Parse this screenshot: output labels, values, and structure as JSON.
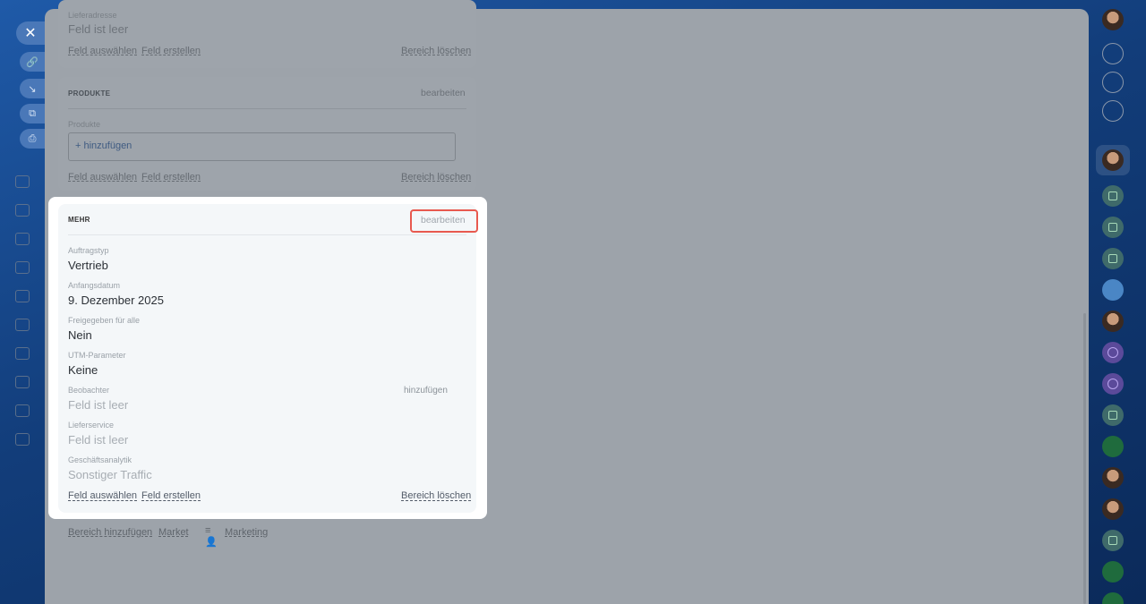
{
  "delivery_card": {
    "field_label": "Lieferadresse",
    "field_value": "Feld ist leer",
    "select_field": "Feld auswählen",
    "create_field": "Feld erstellen",
    "delete_section": "Bereich löschen"
  },
  "products_card": {
    "title": "PRODUKTE",
    "edit": "bearbeiten",
    "field_label": "Produkte",
    "add_product": "+ hinzufügen",
    "select_field": "Feld auswählen",
    "create_field": "Feld erstellen",
    "delete_section": "Bereich löschen"
  },
  "more_card": {
    "title": "MEHR",
    "edit": "bearbeiten",
    "fields": [
      {
        "label": "Auftragstyp",
        "value": "Vertrieb"
      },
      {
        "label": "Anfangsdatum",
        "value": "9. Dezember 2025"
      },
      {
        "label": "Freigegeben für alle",
        "value": "Nein"
      },
      {
        "label": "UTM-Parameter",
        "value": "Keine"
      },
      {
        "label": "Beobachter",
        "value": "Feld ist leer",
        "action": "hinzufügen"
      },
      {
        "label": "Lieferservice",
        "value": "Feld ist leer"
      },
      {
        "label": "Geschäftsanalytik",
        "value": "Sonstiger Traffic"
      }
    ],
    "select_field": "Feld auswählen",
    "create_field": "Feld erstellen",
    "delete_section": "Bereich löschen"
  },
  "footer_links": {
    "add_section": "Bereich hinzufügen",
    "market": "Market",
    "marketing": "Marketing"
  },
  "colors": {
    "highlight_border": "#e8594f",
    "background_blue": "#1f5aa8"
  }
}
